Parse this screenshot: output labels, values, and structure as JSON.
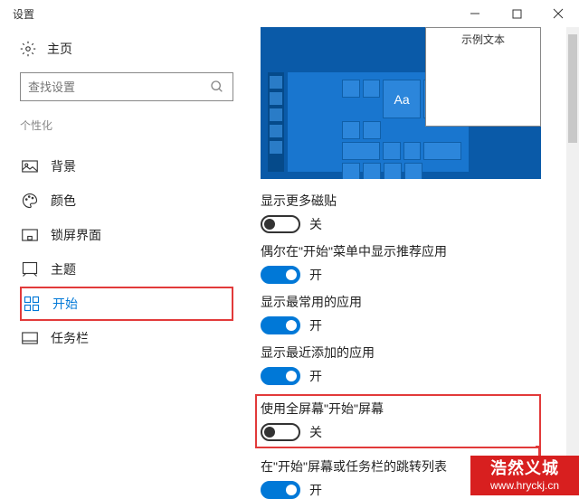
{
  "window": {
    "title": "设置"
  },
  "wincontrols": {
    "min": "–",
    "max": "▢",
    "close": "✕"
  },
  "sidebar": {
    "home": "主页",
    "search_placeholder": "查找设置",
    "section": "个性化",
    "items": [
      {
        "label": "背景"
      },
      {
        "label": "颜色"
      },
      {
        "label": "锁屏界面"
      },
      {
        "label": "主题"
      },
      {
        "label": "开始"
      },
      {
        "label": "任务栏"
      }
    ]
  },
  "preview": {
    "sample_text": "示例文本",
    "tile_label": "Aa"
  },
  "settings": [
    {
      "label": "显示更多磁贴",
      "state": "off",
      "state_text": "关"
    },
    {
      "label": "偶尔在\"开始\"菜单中显示推荐应用",
      "state": "on",
      "state_text": "开"
    },
    {
      "label": "显示最常用的应用",
      "state": "on",
      "state_text": "开"
    },
    {
      "label": "显示最近添加的应用",
      "state": "on",
      "state_text": "开"
    },
    {
      "label": "使用全屏幕\"开始\"屏幕",
      "state": "off",
      "state_text": "关",
      "highlighted": true
    },
    {
      "label": "在\"开始\"屏幕或任务栏的跳转列表",
      "state": "on",
      "state_text": "开"
    }
  ],
  "watermark": {
    "line1": "浩然义城",
    "line2": "www.hryckj.cn"
  }
}
